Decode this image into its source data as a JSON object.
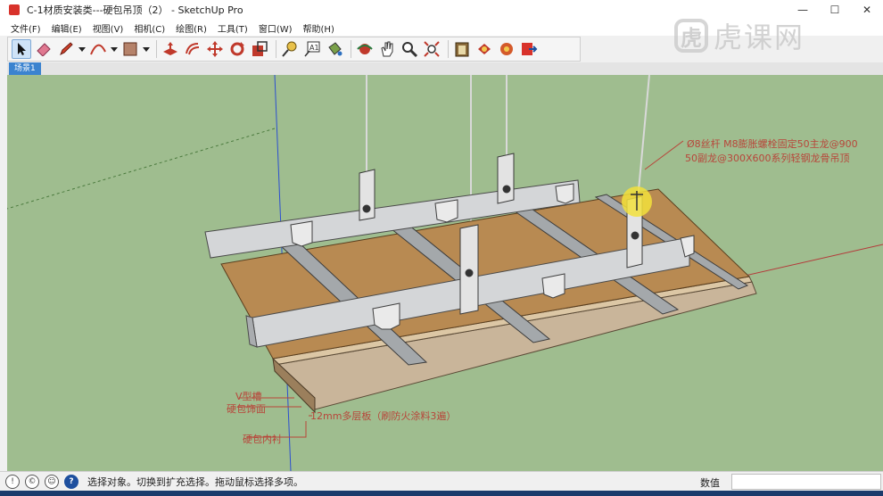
{
  "window": {
    "title": "C-1材质安装类---硬包吊顶（2） - SketchUp Pro",
    "minimize": "—",
    "maximize": "☐",
    "close": "✕"
  },
  "menu": [
    "文件(F)",
    "编辑(E)",
    "视图(V)",
    "相机(C)",
    "绘图(R)",
    "工具(T)",
    "窗口(W)",
    "帮助(H)"
  ],
  "toolbar": {
    "tools": [
      "select-icon",
      "eraser-icon",
      "pencil-icon",
      "dropdown-icon",
      "arc-icon",
      "dropdown-icon",
      "rectangle-icon",
      "dropdown-icon",
      "push-pull-icon",
      "offset-icon",
      "move-icon",
      "rotate-icon",
      "scale-icon",
      "tape-measure-icon",
      "text-icon",
      "paint-bucket-icon",
      "orbit-icon",
      "pan-icon",
      "zoom-icon",
      "zoom-extents-icon",
      "warehouse-icon",
      "share-model-icon",
      "components-icon",
      "send-to-layout-icon"
    ]
  },
  "scene": {
    "tab": "场景1"
  },
  "annotations": {
    "rod_line1": "Ø8丝杆 M8膨胀螺栓固定50主龙@900",
    "rod_line2": "50副龙@300X600系列轻钢龙骨吊顶",
    "v_groove": "V型槽",
    "panel_face": "硬包饰面",
    "plywood": "12mm多层板（刷防火涂料3遍）",
    "inner_lining": "硬包内衬"
  },
  "status": {
    "message": "选择对象。切换到扩充选择。拖动鼠标选择多项。",
    "measure_label": "数值",
    "measure_value": ""
  },
  "watermark": {
    "logo": "虎",
    "text": "虎课网"
  },
  "colors": {
    "viewport_bg": "#9fbd8f",
    "plywood": "#b88a52",
    "steel": "#cfd2d4",
    "accent": "#3b83cf"
  }
}
